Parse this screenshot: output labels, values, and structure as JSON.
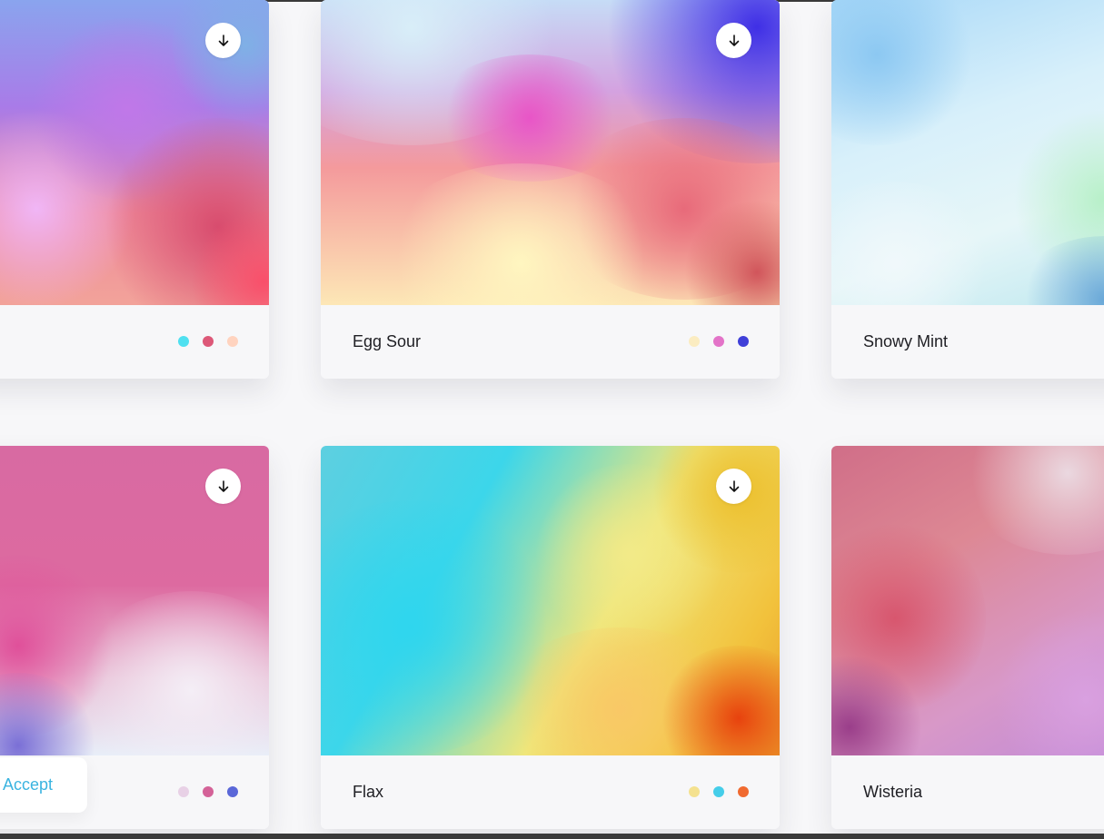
{
  "cards": [
    {
      "title": "",
      "dots": [
        "#4fe0f0",
        "#dd5878",
        "#ffd3bf"
      ],
      "has_download": true
    },
    {
      "title": "Egg Sour",
      "dots": [
        "#fbecc1",
        "#e373c8",
        "#3f3fd8"
      ],
      "has_download": true
    },
    {
      "title": "Snowy Mint",
      "dots": [],
      "has_download": false
    },
    {
      "title": "",
      "dots": [
        "#e8d1e6",
        "#d46298",
        "#5a67d8"
      ],
      "has_download": true
    },
    {
      "title": "Flax",
      "dots": [
        "#f4e18f",
        "#45cde9",
        "#f06a30"
      ],
      "has_download": true
    },
    {
      "title": "Wisteria",
      "dots": [],
      "has_download": false
    }
  ],
  "icons": {
    "download": "arrow-down-icon"
  },
  "cookie": {
    "accept_label": "Accept"
  }
}
